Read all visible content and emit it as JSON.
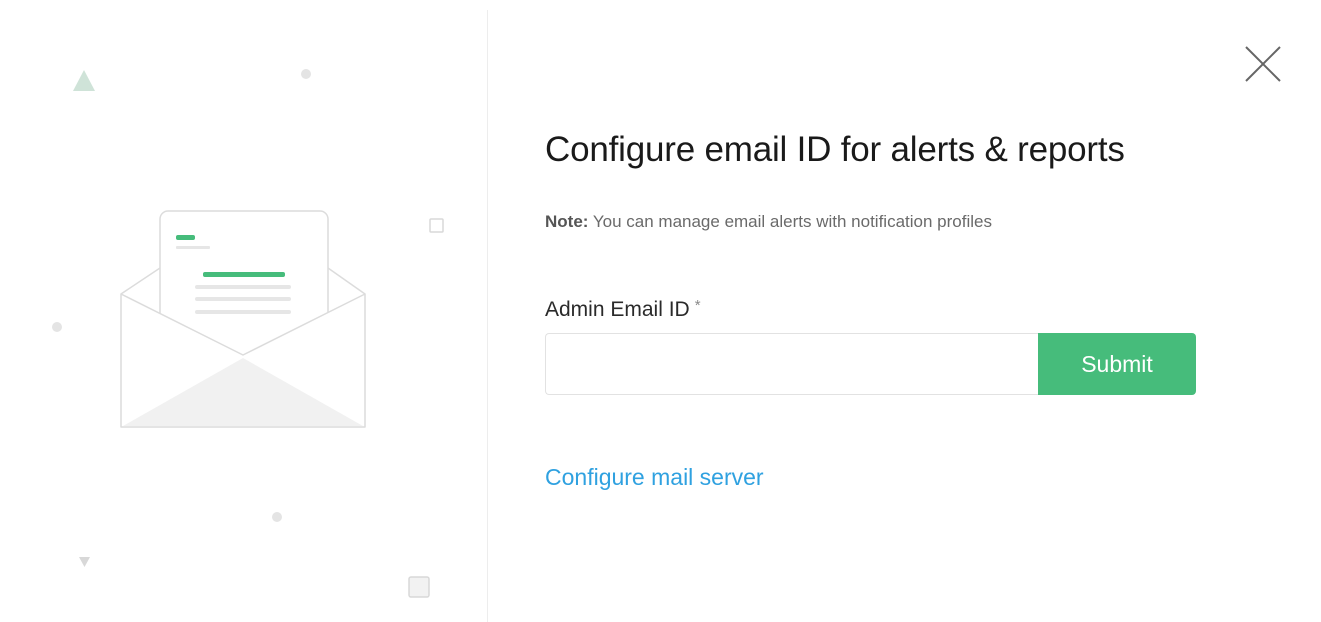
{
  "dialog": {
    "title": "Configure email ID for alerts & reports",
    "note_label": "Note:",
    "note_text": " You can manage email alerts with notification profiles",
    "field_label": "Admin Email ID",
    "required_mark": "*",
    "email_value": "",
    "email_placeholder": "",
    "submit_label": "Submit",
    "mail_server_link": "Configure mail server"
  },
  "icons": {
    "close": "close-icon",
    "illustration": "envelope-illustration"
  },
  "colors": {
    "accent": "#46bc7b",
    "link": "#2fa1e0",
    "title": "#1a1a1a",
    "muted": "#6a6a6a"
  }
}
